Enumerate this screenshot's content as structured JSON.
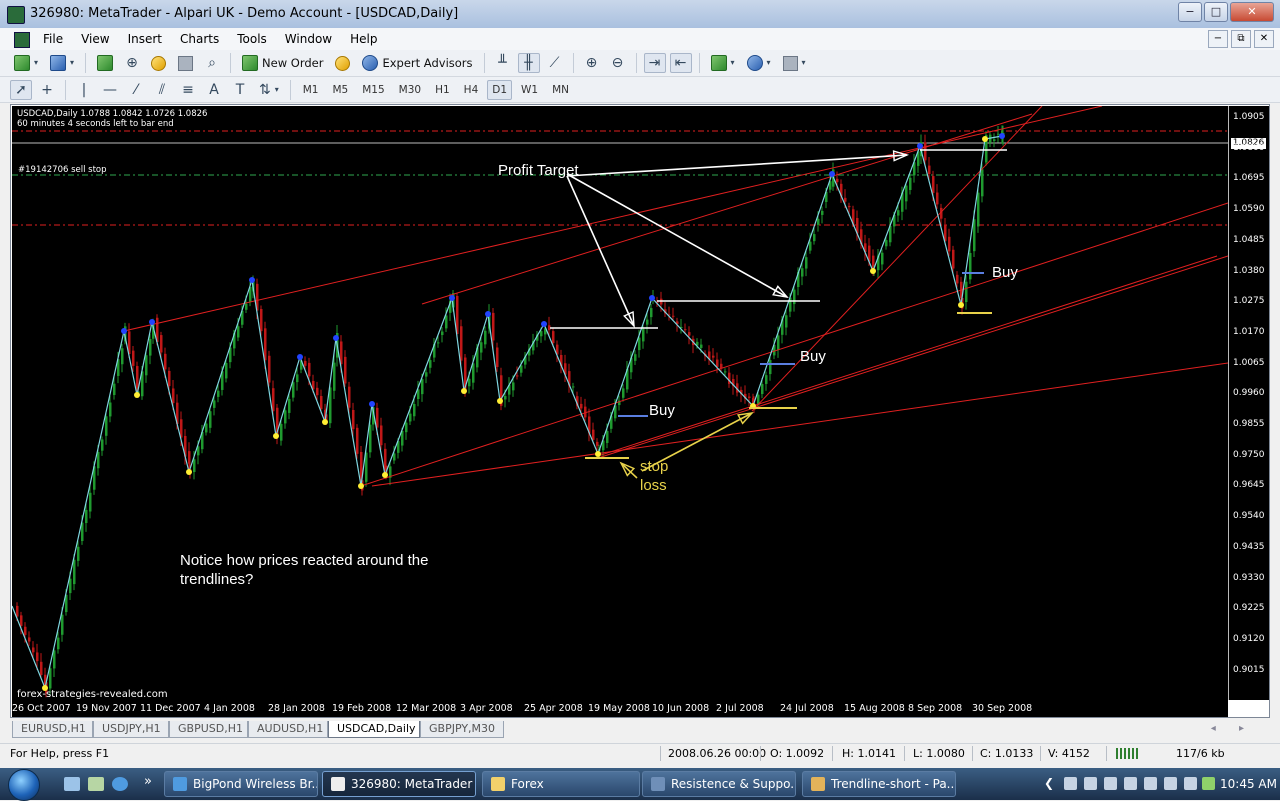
{
  "window": {
    "title": "326980: MetaTrader - Alpari UK - Demo Account - [USDCAD,Daily]",
    "buttons": [
      "−",
      "□",
      "✕"
    ]
  },
  "menu": {
    "items": [
      "File",
      "View",
      "Insert",
      "Charts",
      "Tools",
      "Window",
      "Help"
    ],
    "mdi_buttons": [
      "−",
      "⧉",
      "✕"
    ]
  },
  "toolbar": {
    "new_order_label": "New Order",
    "expert_advisors_label": "Expert Advisors",
    "timeframes": [
      "M1",
      "M5",
      "M15",
      "M30",
      "H1",
      "H4",
      "D1",
      "W1",
      "MN"
    ],
    "active_timeframe": "D1"
  },
  "chart": {
    "symbol_line": "USDCAD,Daily  1.0788 1.0842 1.0726 1.0826",
    "timer_line": "60 minutes 4 seconds left to bar end",
    "order_label": "#19142706 sell stop",
    "watermark": "forex-strategies-revealed.com",
    "current_price": "1.0826",
    "price_ticks": [
      "1.0905",
      "1.0800",
      "1.0695",
      "1.0590",
      "1.0485",
      "1.0380",
      "1.0275",
      "1.0170",
      "1.0065",
      "0.9960",
      "0.9855",
      "0.9750",
      "0.9645",
      "0.9540",
      "0.9435",
      "0.9330",
      "0.9225",
      "0.9120",
      "0.9015"
    ],
    "time_ticks": [
      "26 Oct 2007",
      "19 Nov 2007",
      "11 Dec 2007",
      "4 Jan 2008",
      "28 Jan 2008",
      "19 Feb 2008",
      "12 Mar 2008",
      "3 Apr 2008",
      "25 Apr 2008",
      "19 May 2008",
      "10 Jun 2008",
      "2 Jul 2008",
      "24 Jul 2008",
      "15 Aug 2008",
      "8 Sep 2008",
      "30 Sep 2008"
    ],
    "annotations": {
      "profit_target": "Profit Target",
      "buy_1": "Buy",
      "buy_2": "Buy",
      "buy_3": "Buy",
      "stop_loss_1": "stop",
      "stop_loss_2": "loss",
      "notice_1": "Notice how prices reacted around the",
      "notice_2": "trendlines?"
    },
    "colors": {
      "background": "#000000",
      "trendline": "#e02020",
      "zigzag": "#7fd6e0",
      "bull_candle": "#1f9a2f",
      "bear_candle": "#c01818",
      "stop_loss": "#e8d24a",
      "buy_line": "#5a7ee0",
      "annotation": "#ffffff"
    }
  },
  "tabs": {
    "items": [
      "EURUSD,H1",
      "USDJPY,H1",
      "GBPUSD,H1",
      "AUDUSD,H1",
      "USDCAD,Daily",
      "GBPJPY,M30"
    ],
    "active": "USDCAD,Daily",
    "arrows": "◂ ▸"
  },
  "status": {
    "help": "For Help, press F1",
    "datetime": "2008.06.26 00:00",
    "open": "O: 1.0092",
    "high": "H: 1.0141",
    "low": "L: 1.0080",
    "close": "C: 1.0133",
    "volume": "V: 4152",
    "traffic": "117/6 kb"
  },
  "taskbar": {
    "quicklaunch_more": "»",
    "items": [
      "BigPond Wireless Br...",
      "326980: MetaTrader ...",
      "Forex",
      "Resistence & Suppo...",
      "Trendline-short - Pa..."
    ],
    "active_index": 1,
    "tray_chevron": "❮",
    "time": "10:45 AM"
  }
}
